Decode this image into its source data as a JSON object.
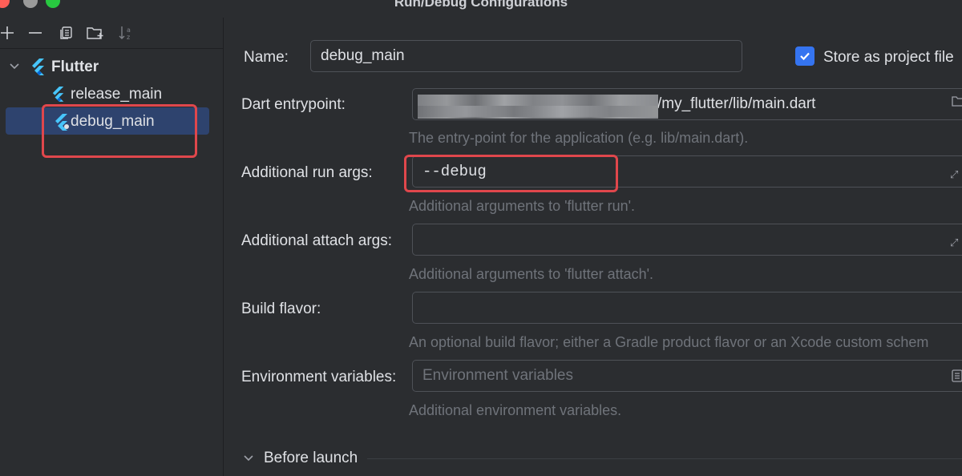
{
  "window": {
    "title": "Run/Debug Configurations"
  },
  "toolbar": {
    "icons": [
      "add-icon",
      "remove-icon",
      "copy-icon",
      "new-folder-icon",
      "sort-icon"
    ]
  },
  "tree": {
    "group_label": "Flutter",
    "items": [
      {
        "label": "release_main",
        "selected": false
      },
      {
        "label": "debug_main",
        "selected": true
      }
    ]
  },
  "form": {
    "name_label": "Name:",
    "name_value": "debug_main",
    "store_label": "Store as project file",
    "store_checked": true,
    "entrypoint_label": "Dart entrypoint:",
    "entrypoint_value": "/my_flutter/lib/main.dart",
    "entrypoint_hint": "The entry-point for the application (e.g. lib/main.dart).",
    "run_args_label": "Additional run args:",
    "run_args_value": "--debug",
    "run_args_hint": "Additional arguments to 'flutter run'.",
    "attach_args_label": "Additional attach args:",
    "attach_args_value": "",
    "attach_args_hint": "Additional arguments to 'flutter attach'.",
    "flavor_label": "Build flavor:",
    "flavor_value": "",
    "flavor_hint": "An optional build flavor; either a Gradle product flavor or an Xcode custom schem",
    "env_label": "Environment variables:",
    "env_placeholder": "Environment variables",
    "env_hint": "Additional environment variables.",
    "before_launch_label": "Before launch"
  },
  "colors": {
    "accent": "#3574f0",
    "highlight": "#e0474c",
    "selection": "#2e436e",
    "flutter_blue": "#47c5fb"
  }
}
